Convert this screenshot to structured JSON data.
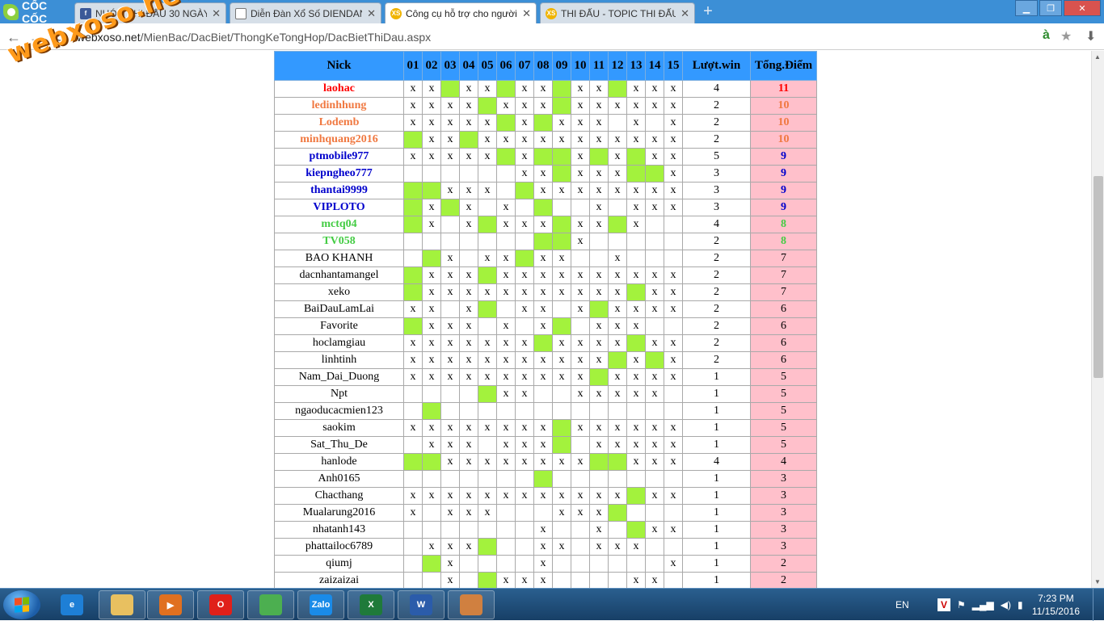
{
  "browser": {
    "brand": "CỐC CỐC",
    "tabs": [
      {
        "title": "NHÓM THI ĐẤU 30 NGÀY",
        "icon": "facebook-icon",
        "active": false
      },
      {
        "title": "Diễn Đàn Xổ Số DIENDAN",
        "icon": "document-icon",
        "active": false
      },
      {
        "title": "Công cụ hỗ trợ cho người",
        "icon": "xoso-icon",
        "active": true
      },
      {
        "title": "THI ĐẤU - TOPIC THI ĐẤU",
        "icon": "xoso-icon",
        "active": false
      }
    ],
    "tab_close": "✕",
    "new_tab": "+",
    "window_controls": {
      "minimize": "▁",
      "maximize": "❐",
      "close": "✕"
    },
    "url": {
      "host": "webxoso.net",
      "path": "/MienBac/DacBiet/ThongKeTongHop/DacBietThiDau.aspx"
    },
    "xs_label": "XS"
  },
  "watermark": "webxoso.net",
  "table": {
    "headers": [
      "Nick",
      "01",
      "02",
      "03",
      "04",
      "05",
      "06",
      "07",
      "08",
      "09",
      "10",
      "11",
      "12",
      "13",
      "14",
      "15",
      "Lượt.win",
      "Tổng.Điểm"
    ],
    "rows": [
      {
        "nick": "laohac",
        "style": "red",
        "days": [
          "x",
          "x",
          "H",
          "x",
          "x",
          "H",
          "x",
          "x",
          "H",
          "x",
          "x",
          "H",
          "x",
          "x",
          "x"
        ],
        "wins": "4",
        "total": "11"
      },
      {
        "nick": "ledinhhung",
        "style": "orange",
        "days": [
          "x",
          "x",
          "x",
          "x",
          "H",
          "x",
          "x",
          "x",
          "H",
          "x",
          "x",
          "x",
          "x",
          "x",
          "x"
        ],
        "wins": "2",
        "total": "10"
      },
      {
        "nick": "Lodemb",
        "style": "orange",
        "days": [
          "x",
          "x",
          "x",
          "x",
          "x",
          "H",
          "x",
          "H",
          "x",
          "x",
          "x",
          "",
          "x",
          "",
          "x"
        ],
        "wins": "2",
        "total": "10"
      },
      {
        "nick": "minhquang2016",
        "style": "orange",
        "days": [
          "H",
          "x",
          "x",
          "H",
          "x",
          "x",
          "x",
          "x",
          "x",
          "x",
          "x",
          "x",
          "x",
          "x",
          "x"
        ],
        "wins": "2",
        "total": "10"
      },
      {
        "nick": "ptmobile977",
        "style": "blue",
        "days": [
          "x",
          "x",
          "x",
          "x",
          "x",
          "H",
          "x",
          "H",
          "H",
          "x",
          "H",
          "x",
          "H",
          "x",
          "x"
        ],
        "wins": "5",
        "total": "9"
      },
      {
        "nick": "kiepngheo777",
        "style": "blue",
        "days": [
          "",
          "",
          "",
          "",
          "",
          "",
          "x",
          "x",
          "H",
          "x",
          "x",
          "x",
          "H",
          "H",
          "x"
        ],
        "wins": "3",
        "total": "9"
      },
      {
        "nick": "thantai9999",
        "style": "blue",
        "days": [
          "H",
          "H",
          "x",
          "x",
          "x",
          "",
          "H",
          "x",
          "x",
          "x",
          "x",
          "x",
          "x",
          "x",
          "x"
        ],
        "wins": "3",
        "total": "9"
      },
      {
        "nick": "VIPLOTO",
        "style": "blue",
        "days": [
          "H",
          "x",
          "H",
          "x",
          "",
          "x",
          "",
          "H",
          "",
          "",
          "x",
          "",
          "x",
          "x",
          "x"
        ],
        "wins": "3",
        "total": "9"
      },
      {
        "nick": "mctq04",
        "style": "green",
        "days": [
          "H",
          "x",
          "",
          "x",
          "H",
          "x",
          "x",
          "x",
          "H",
          "x",
          "x",
          "H",
          "x",
          "",
          ""
        ],
        "wins": "4",
        "total": "8"
      },
      {
        "nick": "TV058",
        "style": "green",
        "days": [
          "",
          "",
          "",
          "",
          "",
          "",
          "",
          "H",
          "H",
          "x",
          "",
          "",
          "",
          "",
          ""
        ],
        "wins": "2",
        "total": "8"
      },
      {
        "nick": "BAO KHANH",
        "style": "normal",
        "days": [
          "",
          "H",
          "x",
          "",
          "x",
          "x",
          "H",
          "x",
          "x",
          "",
          "",
          "x",
          "",
          "",
          ""
        ],
        "wins": "2",
        "total": "7"
      },
      {
        "nick": "dacnhantamangel",
        "style": "normal",
        "days": [
          "H",
          "x",
          "x",
          "x",
          "H",
          "x",
          "x",
          "x",
          "x",
          "x",
          "x",
          "x",
          "x",
          "x",
          "x"
        ],
        "wins": "2",
        "total": "7"
      },
      {
        "nick": "xeko",
        "style": "normal",
        "days": [
          "H",
          "x",
          "x",
          "x",
          "x",
          "x",
          "x",
          "x",
          "x",
          "x",
          "x",
          "x",
          "H",
          "x",
          "x"
        ],
        "wins": "2",
        "total": "7"
      },
      {
        "nick": "BaiDauLamLai",
        "style": "normal",
        "days": [
          "x",
          "x",
          "",
          "x",
          "H",
          "",
          "x",
          "x",
          "",
          "x",
          "H",
          "x",
          "x",
          "x",
          "x"
        ],
        "wins": "2",
        "total": "6"
      },
      {
        "nick": "Favorite",
        "style": "normal",
        "days": [
          "H",
          "x",
          "x",
          "x",
          "",
          "x",
          "",
          "x",
          "H",
          "",
          "x",
          "x",
          "x",
          "",
          ""
        ],
        "wins": "2",
        "total": "6"
      },
      {
        "nick": "hoclamgiau",
        "style": "normal",
        "days": [
          "x",
          "x",
          "x",
          "x",
          "x",
          "x",
          "x",
          "H",
          "x",
          "x",
          "x",
          "x",
          "H",
          "x",
          "x"
        ],
        "wins": "2",
        "total": "6"
      },
      {
        "nick": "linhtinh",
        "style": "normal",
        "days": [
          "x",
          "x",
          "x",
          "x",
          "x",
          "x",
          "x",
          "x",
          "x",
          "x",
          "x",
          "H",
          "x",
          "H",
          "x"
        ],
        "wins": "2",
        "total": "6"
      },
      {
        "nick": "Nam_Dai_Duong",
        "style": "normal",
        "days": [
          "x",
          "x",
          "x",
          "x",
          "x",
          "x",
          "x",
          "x",
          "x",
          "x",
          "H",
          "x",
          "x",
          "x",
          "x"
        ],
        "wins": "1",
        "total": "5"
      },
      {
        "nick": "Npt",
        "style": "normal",
        "days": [
          "",
          "",
          "",
          "",
          "H",
          "x",
          "x",
          "",
          "",
          "x",
          "x",
          "x",
          "x",
          "x",
          ""
        ],
        "wins": "1",
        "total": "5"
      },
      {
        "nick": "ngaoducacmien123",
        "style": "normal",
        "days": [
          "",
          "H",
          "",
          "",
          "",
          "",
          "",
          "",
          "",
          "",
          "",
          "",
          "",
          "",
          ""
        ],
        "wins": "1",
        "total": "5"
      },
      {
        "nick": "saokim",
        "style": "normal",
        "days": [
          "x",
          "x",
          "x",
          "x",
          "x",
          "x",
          "x",
          "x",
          "H",
          "x",
          "x",
          "x",
          "x",
          "x",
          "x"
        ],
        "wins": "1",
        "total": "5"
      },
      {
        "nick": "Sat_Thu_De",
        "style": "normal",
        "days": [
          "",
          "x",
          "x",
          "x",
          "",
          "x",
          "x",
          "x",
          "H",
          "",
          "x",
          "x",
          "x",
          "x",
          "x"
        ],
        "wins": "1",
        "total": "5"
      },
      {
        "nick": "hanlode",
        "style": "normal",
        "days": [
          "H",
          "H",
          "x",
          "x",
          "x",
          "x",
          "x",
          "x",
          "x",
          "x",
          "H",
          "H",
          "x",
          "x",
          "x"
        ],
        "wins": "4",
        "total": "4"
      },
      {
        "nick": "Anh0165",
        "style": "normal",
        "days": [
          "",
          "",
          "",
          "",
          "",
          "",
          "",
          "H",
          "",
          "",
          "",
          "",
          "",
          "",
          ""
        ],
        "wins": "1",
        "total": "3"
      },
      {
        "nick": "Chacthang",
        "style": "normal",
        "days": [
          "x",
          "x",
          "x",
          "x",
          "x",
          "x",
          "x",
          "x",
          "x",
          "x",
          "x",
          "x",
          "H",
          "x",
          "x"
        ],
        "wins": "1",
        "total": "3"
      },
      {
        "nick": "Mualarung2016",
        "style": "normal",
        "days": [
          "x",
          "",
          "x",
          "x",
          "x",
          "",
          "",
          "",
          "x",
          "x",
          "x",
          "H",
          "",
          "",
          ""
        ],
        "wins": "1",
        "total": "3"
      },
      {
        "nick": "nhatanh143",
        "style": "normal",
        "days": [
          "",
          "",
          "",
          "",
          "",
          "",
          "",
          "x",
          "",
          "",
          "x",
          "",
          "H",
          "x",
          "x"
        ],
        "wins": "1",
        "total": "3"
      },
      {
        "nick": "phattailoc6789",
        "style": "normal",
        "days": [
          "",
          "x",
          "x",
          "x",
          "H",
          "",
          "",
          "x",
          "x",
          "",
          "x",
          "x",
          "x",
          "",
          ""
        ],
        "wins": "1",
        "total": "3"
      },
      {
        "nick": "qiumj",
        "style": "normal",
        "days": [
          "",
          "H",
          "x",
          "",
          "",
          "",
          "",
          "x",
          "",
          "",
          "",
          "",
          "",
          "",
          "x"
        ],
        "wins": "1",
        "total": "2"
      },
      {
        "nick": "zaizaizai",
        "style": "normal",
        "days": [
          "",
          "",
          "x",
          "",
          "H",
          "x",
          "x",
          "x",
          "",
          "",
          "",
          "",
          "x",
          "x",
          ""
        ],
        "wins": "1",
        "total": "2"
      }
    ]
  },
  "taskbar": {
    "apps": [
      {
        "name": "ie-icon",
        "label": "e",
        "color": "#1e7fd6"
      },
      {
        "name": "explorer-icon",
        "label": "",
        "color": "#e8c060"
      },
      {
        "name": "media-player-icon",
        "label": "▶",
        "color": "#e07020"
      },
      {
        "name": "opera-icon",
        "label": "O",
        "color": "#e0201a"
      },
      {
        "name": "coccoc-icon",
        "label": "",
        "color": "#4caf50"
      },
      {
        "name": "zalo-icon",
        "label": "Zalo",
        "color": "#1a8be8"
      },
      {
        "name": "excel-icon",
        "label": "X",
        "color": "#1f7a3a"
      },
      {
        "name": "word-icon",
        "label": "W",
        "color": "#2b5caa"
      },
      {
        "name": "paint-icon",
        "label": "",
        "color": "#d08040"
      }
    ],
    "lang": "EN",
    "time": "7:23 PM",
    "date": "11/15/2016"
  }
}
